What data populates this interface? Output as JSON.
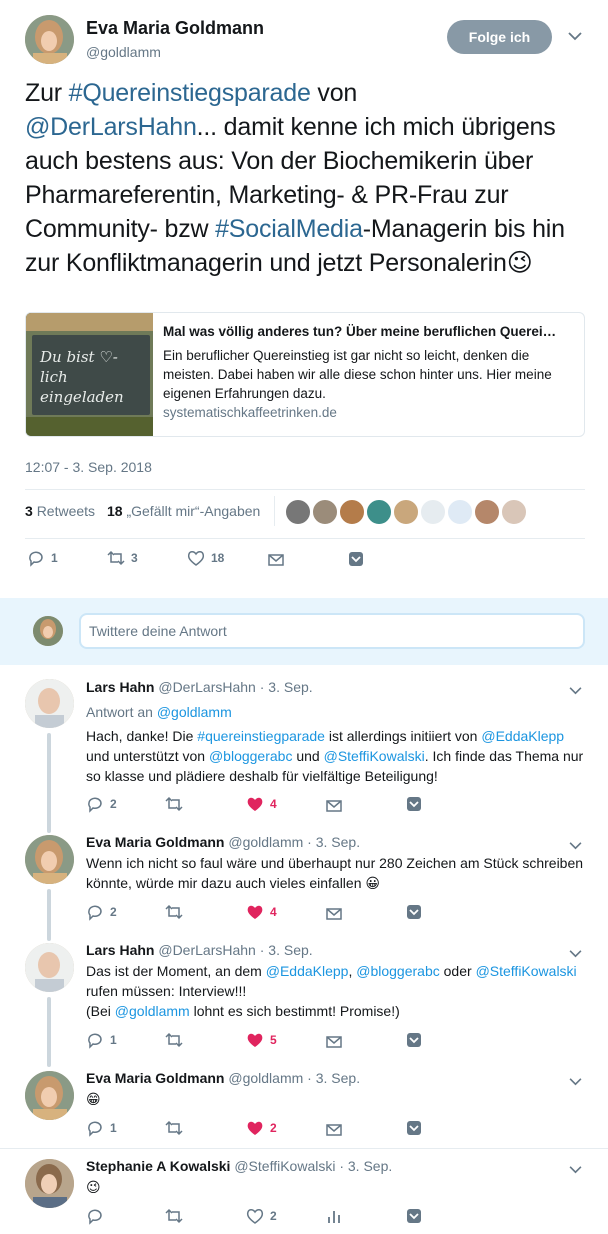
{
  "main_tweet": {
    "author_name": "Eva Maria Goldmann",
    "author_handle": "@goldlamm",
    "follow_label": "Folge ich",
    "text_parts": {
      "p1": "Zur ",
      "hashtag1": "#Quereinstiegsparade",
      "p2": " von",
      "mention1": "@DerLarsHahn",
      "p3": "... damit kenne ich mich übrigens auch bestens aus: Von der Biochemikerin über Pharmareferentin, Marketing- & PR-Frau zur Community- bzw ",
      "hashtag2": "#SocialMedia",
      "p4": "-Managerin bis hin zur Konfliktmanagerin und jetzt Personalerin",
      "emoji": "😉"
    },
    "card": {
      "image_text": "Du bist ♡-lich eingeladen",
      "title": "Mal was völlig anderes tun? Über meine beruflichen Querei…",
      "description": "Ein beruflicher Quereinstieg ist gar nicht so leicht, denken die meisten. Dabei haben wir alle diese schon hinter uns. Hier meine eigenen Erfahrungen dazu.",
      "domain": "systematischkaffeetrinken.de"
    },
    "timestamp": "12:07 - 3. Sep. 2018",
    "stats": {
      "retweets_count": "3",
      "retweets_label": "Retweets",
      "likes_count": "18",
      "likes_label": "„Gefällt mir“-Angaben"
    },
    "actions": {
      "reply": "1",
      "retweet": "3",
      "like": "18"
    }
  },
  "reply_box": {
    "placeholder": "Twittere deine Antwort"
  },
  "replies": [
    {
      "name": "Lars Hahn",
      "handle": "@DerLarsHahn",
      "date": "· 3. Sep.",
      "reply_to_prefix": "Antwort an",
      "reply_to": "@goldlamm",
      "text": {
        "t1": "Hach, danke! Die ",
        "h1": "#quereinstiegparade",
        "t2": " ist allerdings initiiert von ",
        "m1": "@EddaKlepp",
        "t3": " und unterstützt von ",
        "m2": "@bloggerabc",
        "t4": " und ",
        "m3": "@SteffiKowalski",
        "t5": ". Ich finde das Thema nur so klasse und plädiere deshalb für vielfältige Beteiligung!"
      },
      "actions": {
        "reply": "2",
        "retweet": "",
        "like": "4"
      }
    },
    {
      "name": "Eva Maria Goldmann",
      "handle": "@goldlamm",
      "date": "· 3. Sep.",
      "text": "Wenn ich nicht so faul wäre und überhaupt nur 280 Zeichen am Stück schreiben könnte, würde mir dazu auch vieles einfallen",
      "emoji": "😀",
      "actions": {
        "reply": "2",
        "retweet": "",
        "like": "4"
      }
    },
    {
      "name": "Lars Hahn",
      "handle": "@DerLarsHahn",
      "date": "· 3. Sep.",
      "text": {
        "t1": "Das ist der Moment, an dem ",
        "m1": "@EddaKlepp",
        "t2": ", ",
        "m2": "@bloggerabc",
        "t3": " oder ",
        "m3": "@SteffiKowalski",
        "t4": " rufen müssen: Interview!!!",
        "t5": "(Bei ",
        "m4": "@goldlamm",
        "t6": " lohnt es sich bestimmt! Promise!)"
      },
      "actions": {
        "reply": "1",
        "retweet": "",
        "like": "5"
      }
    },
    {
      "name": "Eva Maria Goldmann",
      "handle": "@goldlamm",
      "date": "· 3. Sep.",
      "emoji": "😁",
      "actions": {
        "reply": "1",
        "retweet": "",
        "like": "2"
      }
    },
    {
      "name": "Stephanie A Kowalski",
      "handle": "@SteffiKowalski",
      "date": "· 3. Sep.",
      "emoji": "😉",
      "actions": {
        "reply": "",
        "retweet": "",
        "like": "2"
      }
    }
  ],
  "colors": {
    "link": "#1b95e0",
    "hashtag": "#2c6791",
    "heart": "#e0245e",
    "muted": "#657786"
  }
}
